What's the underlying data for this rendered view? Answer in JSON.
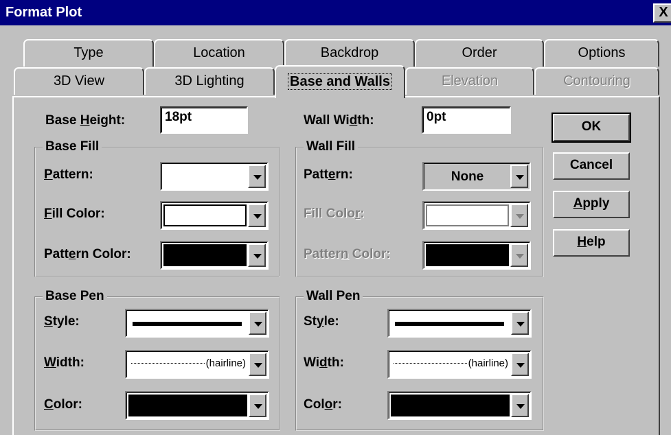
{
  "window": {
    "title": "Format Plot",
    "close_glyph": "X"
  },
  "tabs_back": [
    {
      "label": "Type"
    },
    {
      "label": "Location"
    },
    {
      "label": "Backdrop"
    },
    {
      "label": "Order"
    },
    {
      "label": "Options"
    }
  ],
  "tabs_front": [
    {
      "label": "3D View",
      "state": "normal"
    },
    {
      "label": "3D Lighting",
      "state": "normal"
    },
    {
      "label": "Base and Walls",
      "state": "active"
    },
    {
      "label": "Elevation",
      "state": "disabled"
    },
    {
      "label": "Contouring",
      "state": "disabled"
    }
  ],
  "base_height": {
    "label_pre": "Base ",
    "label_u": "H",
    "label_post": "eight:",
    "value": "18pt"
  },
  "wall_width": {
    "label_pre": "Wall Wi",
    "label_u": "d",
    "label_post": "th:",
    "value": "0pt"
  },
  "base_fill": {
    "title": "Base Fill",
    "pattern": {
      "label_u": "P",
      "label_post": "attern:"
    },
    "fill_color": {
      "label_u": "F",
      "label_post": "ill Color:"
    },
    "pattern_color": {
      "label_pre": "Patt",
      "label_u": "e",
      "label_post": "rn Color:"
    }
  },
  "wall_fill": {
    "title": "Wall Fill",
    "pattern": {
      "label_pre": "Patt",
      "label_u": "e",
      "label_post": "rn:",
      "value": "None"
    },
    "fill_color": {
      "label_pre": "Fill Colo",
      "label_u": "r",
      "label_post": ":"
    },
    "pattern_color": {
      "label_pre": "Patter",
      "label_u": "n",
      "label_post": " Color:"
    }
  },
  "base_pen": {
    "title": "Base Pen",
    "style": {
      "label_u": "S",
      "label_post": "tyle:"
    },
    "width": {
      "label_u": "W",
      "label_post": "idth:",
      "value": "(hairline)"
    },
    "color": {
      "label_u": "C",
      "label_post": "olor:"
    }
  },
  "wall_pen": {
    "title": "Wall Pen",
    "style": {
      "label_pre": "St",
      "label_u": "y",
      "label_post": "le:"
    },
    "width": {
      "label_pre": "Wi",
      "label_u": "d",
      "label_post": "th:",
      "value": "(hairline)"
    },
    "color": {
      "label_pre": "Col",
      "label_u": "o",
      "label_post": "r:"
    }
  },
  "buttons": {
    "ok": {
      "label": "OK"
    },
    "cancel": {
      "label": "Cancel"
    },
    "apply": {
      "label_u": "A",
      "label_post": "pply"
    },
    "help": {
      "label_u": "H",
      "label_post": "elp"
    }
  },
  "colors": {
    "titlebar": "#000080",
    "face": "#c0c0c0",
    "disabled_text": "#808080"
  }
}
